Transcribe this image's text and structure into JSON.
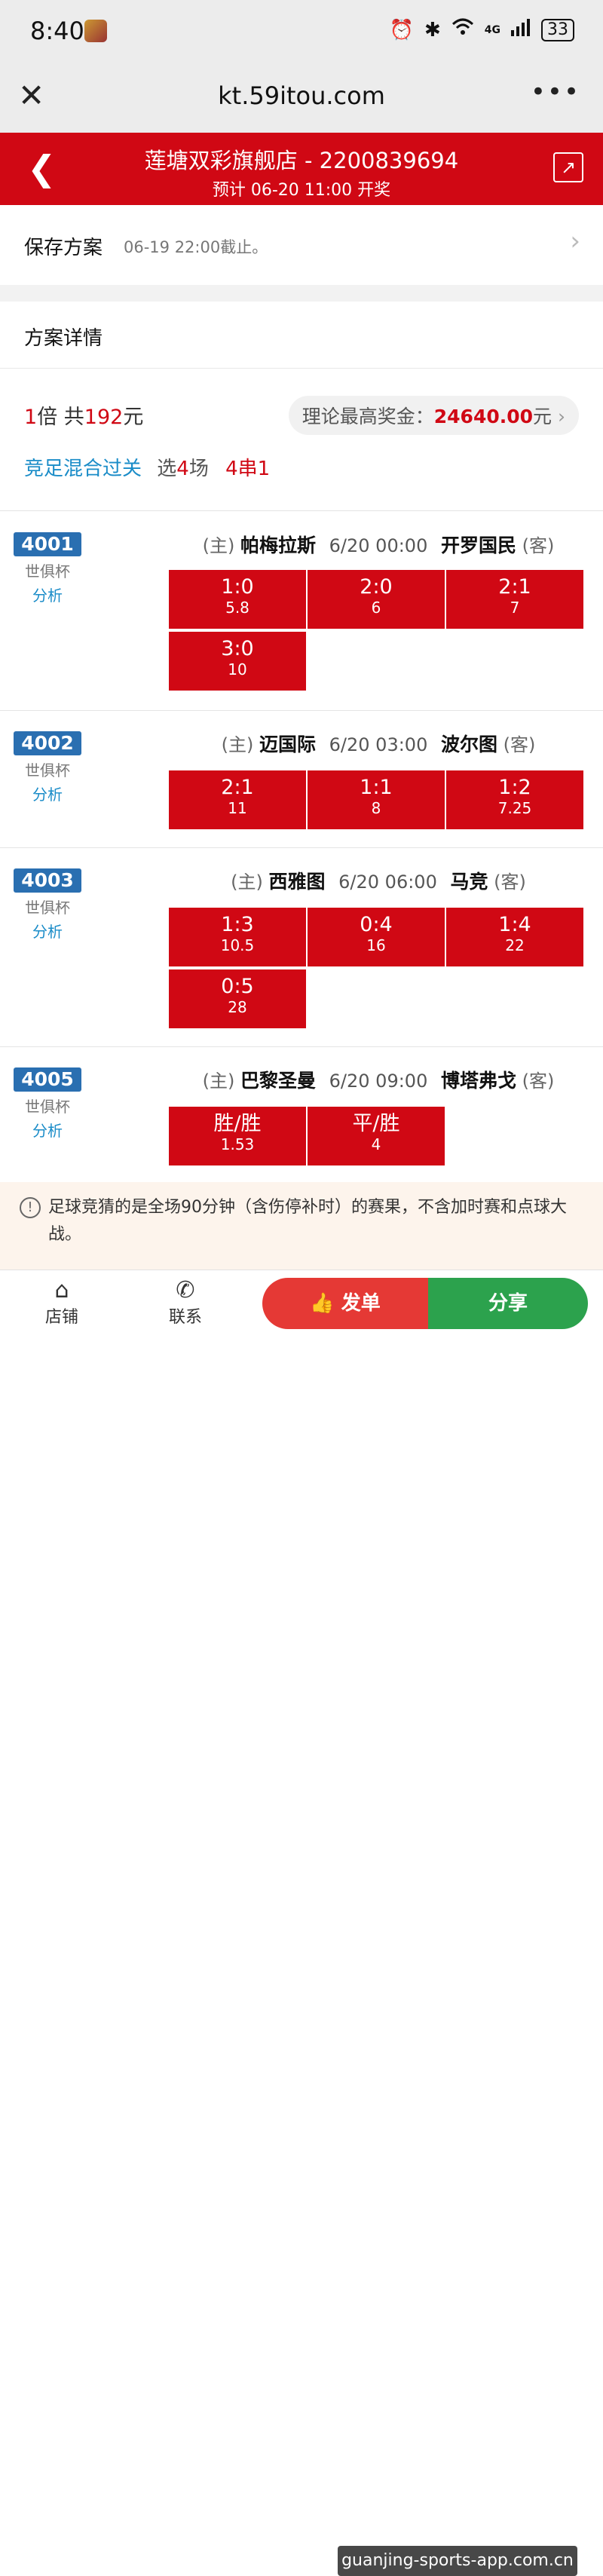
{
  "status_bar": {
    "time": "8:40",
    "battery": "33",
    "network": "4G"
  },
  "browser": {
    "url": "kt.59itou.com",
    "more": "•••"
  },
  "header": {
    "title": "莲塘双彩旗舰店 - 2200839694",
    "subtitle": "预计 06-20 11:00 开奖"
  },
  "save_row": {
    "label": "保存方案",
    "deadline": "06-19 22:00截止。"
  },
  "detail": {
    "label": "方案详情"
  },
  "summary": {
    "multiple": "1",
    "multiple_unit": "倍 共",
    "amount": "192",
    "amount_unit": "元",
    "max_prize_label": "理论最高奖金：",
    "max_prize": "24640.00",
    "max_prize_unit": "元",
    "play_type": "竞足混合过关",
    "select_prefix": "选",
    "select_count": "4",
    "select_suffix": "场",
    "combo": "4串1"
  },
  "matches": [
    {
      "id": "4001",
      "league": "世俱杯",
      "analysis": "分析",
      "home_tag": "(主)",
      "home": "帕梅拉斯",
      "time": "6/20 00:00",
      "away": "开罗国民",
      "away_tag": "(客)",
      "picks": [
        {
          "score": "1:0",
          "odds": "5.8"
        },
        {
          "score": "2:0",
          "odds": "6"
        },
        {
          "score": "2:1",
          "odds": "7"
        },
        {
          "score": "3:0",
          "odds": "10"
        }
      ]
    },
    {
      "id": "4002",
      "league": "世俱杯",
      "analysis": "分析",
      "home_tag": "(主)",
      "home": "迈国际",
      "time": "6/20 03:00",
      "away": "波尔图",
      "away_tag": "(客)",
      "picks": [
        {
          "score": "2:1",
          "odds": "11"
        },
        {
          "score": "1:1",
          "odds": "8"
        },
        {
          "score": "1:2",
          "odds": "7.25"
        }
      ]
    },
    {
      "id": "4003",
      "league": "世俱杯",
      "analysis": "分析",
      "home_tag": "(主)",
      "home": "西雅图",
      "time": "6/20 06:00",
      "away": "马竞",
      "away_tag": "(客)",
      "picks": [
        {
          "score": "1:3",
          "odds": "10.5"
        },
        {
          "score": "0:4",
          "odds": "16"
        },
        {
          "score": "1:4",
          "odds": "22"
        },
        {
          "score": "0:5",
          "odds": "28"
        }
      ]
    },
    {
      "id": "4005",
      "league": "世俱杯",
      "analysis": "分析",
      "home_tag": "(主)",
      "home": "巴黎圣曼",
      "time": "6/20 09:00",
      "away": "博塔弗戈",
      "away_tag": "(客)",
      "picks": [
        {
          "score": "胜/胜",
          "odds": "1.53"
        },
        {
          "score": "平/胜",
          "odds": "4"
        }
      ]
    }
  ],
  "notice": {
    "text": "足球竞猜的是全场90分钟（含伤停补时）的赛果，不含加时赛和点球大战。"
  },
  "bottom_bar": {
    "shop": "店铺",
    "contact": "联系",
    "order_label": "发单",
    "share_label": "分享",
    "watermark": "guanjing-sports-app.com.cn"
  }
}
